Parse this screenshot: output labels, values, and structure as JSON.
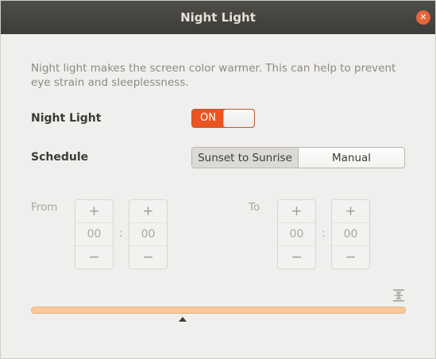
{
  "window": {
    "title": "Night Light",
    "close_icon": "close-icon"
  },
  "description": "Night light makes the screen color warmer. This can help to prevent eye strain and sleeplessness.",
  "night_light": {
    "label": "Night Light",
    "toggle_state": "ON",
    "enabled": true
  },
  "schedule": {
    "label": "Schedule",
    "options": [
      "Sunset to Sunrise",
      "Manual"
    ],
    "selected": "Sunset to Sunrise"
  },
  "from": {
    "label": "From",
    "hours": "00",
    "minutes": "00"
  },
  "to": {
    "label": "To",
    "hours": "00",
    "minutes": "00"
  },
  "spinner": {
    "increment_symbol": "+",
    "decrement_symbol": "−",
    "separator": ":"
  },
  "temperature": {
    "icon": "color-temperature-icon",
    "level": 0.405
  },
  "colors": {
    "accent": "#e95420",
    "slider": "#f9c99a",
    "close": "#e6643a"
  }
}
